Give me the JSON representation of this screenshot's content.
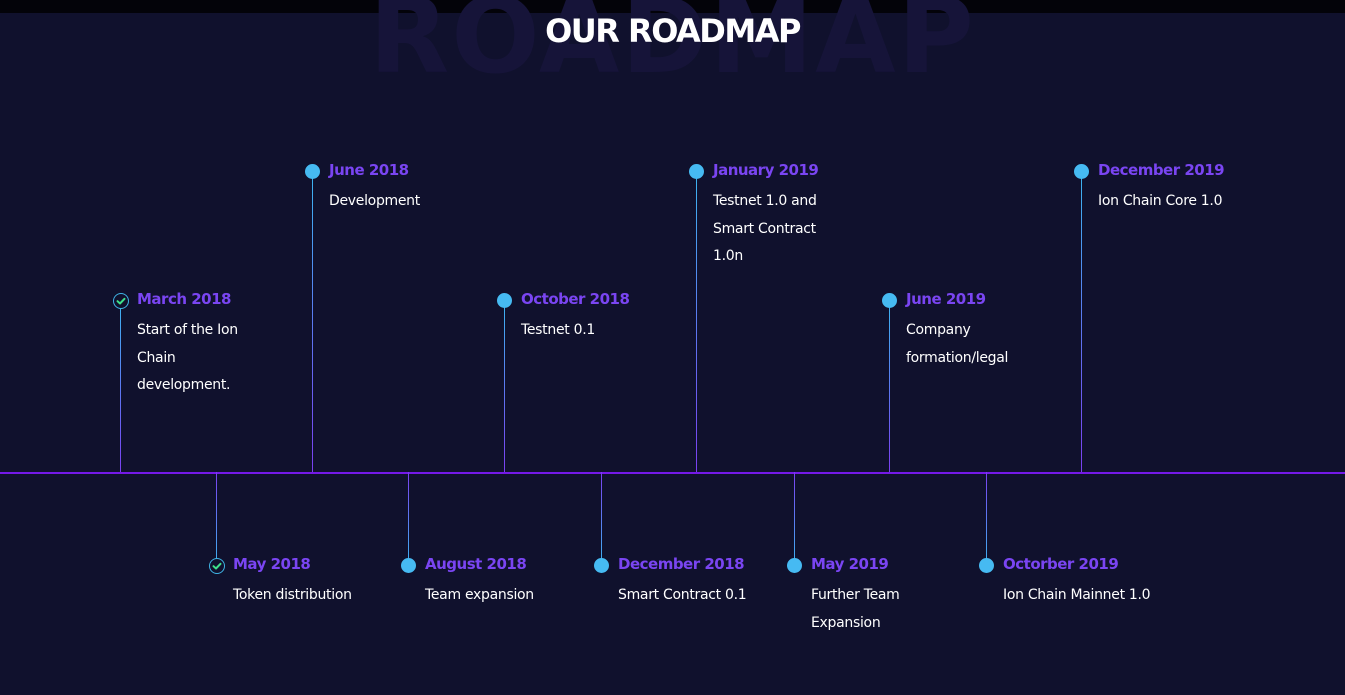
{
  "header": {
    "background_word": "ROADMAP",
    "title": "OUR ROADMAP"
  },
  "colors": {
    "background": "#10112d",
    "timeline": "#7419e8",
    "date": "#7a45f2",
    "dot": "#46baf2",
    "check": "#3ee08a"
  },
  "milestones": [
    {
      "date": "March 2018",
      "description": "Start of the Ion Chain development.",
      "position": "above",
      "status": "completed"
    },
    {
      "date": "May 2018",
      "description": "Token distribution",
      "position": "below",
      "status": "completed"
    },
    {
      "date": "June 2018",
      "description": "Development",
      "position": "above",
      "status": "upcoming"
    },
    {
      "date": "August 2018",
      "description": "Team expansion",
      "position": "below",
      "status": "upcoming"
    },
    {
      "date": "October 2018",
      "description": "Testnet 0.1",
      "position": "above",
      "status": "upcoming"
    },
    {
      "date": "December 2018",
      "description": "Smart Contract 0.1",
      "position": "below",
      "status": "upcoming"
    },
    {
      "date": "January 2019",
      "description": "Testnet 1.0 and Smart Contract 1.0n",
      "position": "above",
      "status": "upcoming"
    },
    {
      "date": "May 2019",
      "description": "Further Team Expansion",
      "position": "below",
      "status": "upcoming"
    },
    {
      "date": "June 2019",
      "description": "Company formation/legal",
      "position": "above",
      "status": "upcoming"
    },
    {
      "date": "Octorber 2019",
      "description": "Ion Chain Mainnet 1.0",
      "position": "below",
      "status": "upcoming"
    },
    {
      "date": "December 2019",
      "description": "Ion Chain Core 1.0",
      "position": "above",
      "status": "upcoming"
    }
  ]
}
